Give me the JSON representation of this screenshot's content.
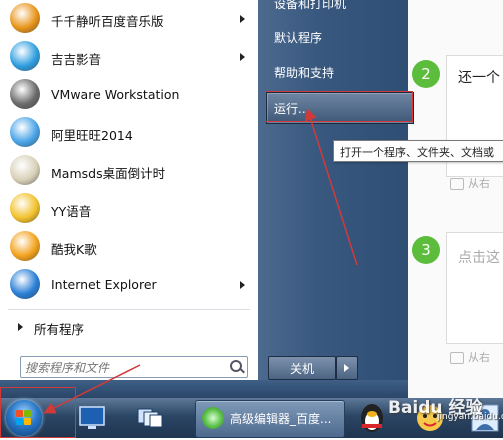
{
  "start_menu": {
    "programs": [
      {
        "label": "千千静听百度音乐版",
        "icon": "qianqian-music-icon",
        "has_submenu": true,
        "color": "#e8941a"
      },
      {
        "label": "吉吉影音",
        "icon": "jijiyingyin-icon",
        "has_submenu": true,
        "color": "#2f9ee0"
      },
      {
        "label": "VMware Workstation",
        "icon": "vmware-icon",
        "has_submenu": false,
        "color": "#6b6b6b"
      },
      {
        "label": "阿里旺旺2014",
        "icon": "aliwangwang-icon",
        "has_submenu": false,
        "color": "#4aa4e8"
      },
      {
        "label": "Mamsds桌面倒计时",
        "icon": "countdown-clock-icon",
        "has_submenu": false,
        "color": "#d8d0b8"
      },
      {
        "label": "YY语音",
        "icon": "yy-voice-icon",
        "has_submenu": false,
        "color": "#f2c12b"
      },
      {
        "label": "酷我K歌",
        "icon": "kuwo-karaoke-icon",
        "has_submenu": false,
        "color": "#f2a21b"
      },
      {
        "label": "Internet Explorer",
        "icon": "internet-explorer-icon",
        "has_submenu": true,
        "color": "#2a7fd6"
      }
    ],
    "all_programs": "所有程序",
    "search_placeholder": "搜索程序和文件",
    "right_items": {
      "devices": "设备和打印机",
      "default_programs": "默认程序",
      "help": "帮助和支持",
      "run": "运行..."
    },
    "shutdown": "关机",
    "tooltip": "打开一个程序、文件夹、文档或"
  },
  "webpage": {
    "steps": [
      {
        "number": "2",
        "text": "还一个"
      },
      {
        "number": "3",
        "text": "点击这"
      }
    ],
    "from_here": "从右"
  },
  "taskbar": {
    "active_window": "高级编辑器_百度..."
  },
  "watermark": {
    "brand": "Baidu 经验",
    "url": "jingyan.baidu.com"
  },
  "colors": {
    "highlight_red": "#d23a3a",
    "step_green": "#5cbd3c"
  }
}
